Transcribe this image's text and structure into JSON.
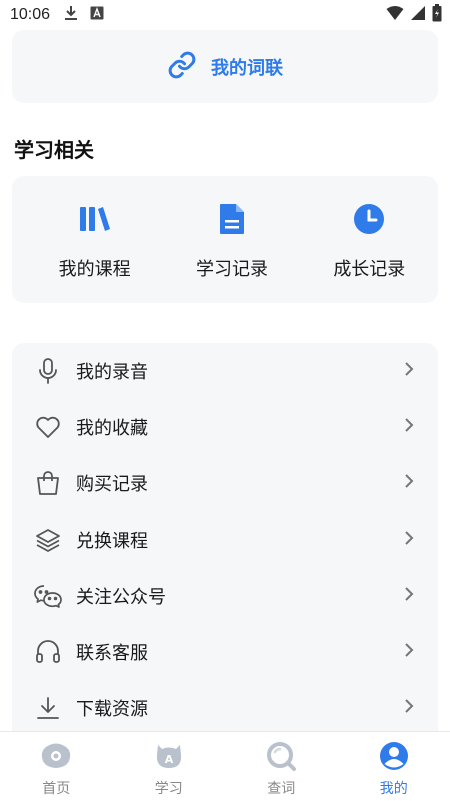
{
  "status_bar": {
    "time": "10:06"
  },
  "word_link": {
    "label": "我的词联"
  },
  "study_section": {
    "title": "学习相关",
    "items": [
      {
        "label": "我的课程",
        "icon": "library-icon"
      },
      {
        "label": "学习记录",
        "icon": "document-icon"
      },
      {
        "label": "成长记录",
        "icon": "clock-icon"
      }
    ]
  },
  "menu": [
    {
      "label": "我的录音",
      "icon": "microphone-icon"
    },
    {
      "label": "我的收藏",
      "icon": "heart-icon"
    },
    {
      "label": "购买记录",
      "icon": "shopping-bag-icon"
    },
    {
      "label": "兑换课程",
      "icon": "layers-icon"
    },
    {
      "label": "关注公众号",
      "icon": "wechat-icon"
    },
    {
      "label": "联系客服",
      "icon": "headphones-icon"
    },
    {
      "label": "下载资源",
      "icon": "download-icon"
    }
  ],
  "tabs": [
    {
      "label": "首页",
      "icon": "home-icon",
      "active": false
    },
    {
      "label": "学习",
      "icon": "study-icon",
      "active": false
    },
    {
      "label": "查词",
      "icon": "search-icon",
      "active": false
    },
    {
      "label": "我的",
      "icon": "profile-icon",
      "active": true
    }
  ],
  "colors": {
    "accent": "#2f7bea",
    "card_bg": "#f6f7f9",
    "inactive": "#b9c1cc"
  }
}
